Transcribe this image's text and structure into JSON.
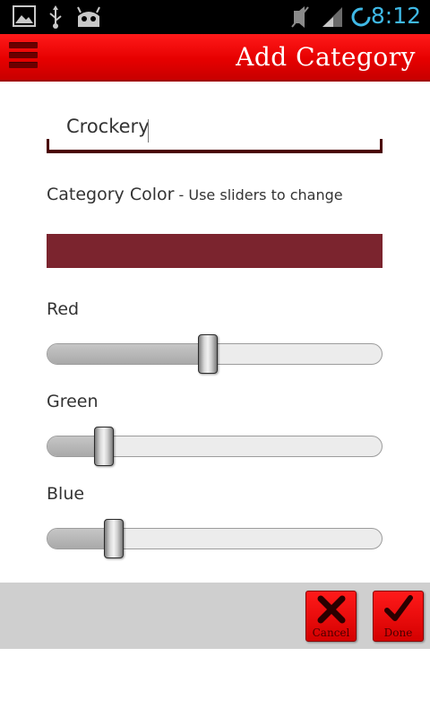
{
  "status_bar": {
    "time": "8:12",
    "icons": [
      "image-icon",
      "usb-icon",
      "android-robot-icon",
      "mute-icon",
      "signal-icon",
      "sync-icon"
    ]
  },
  "action_bar": {
    "title": "Add Category",
    "menu_icon": "menu-icon"
  },
  "form": {
    "name_value": "Crockery",
    "color_label": "Category Color",
    "color_hint": " - Use sliders to change",
    "swatch_color": "#7b242e"
  },
  "sliders": [
    {
      "label": "Red",
      "value": 0.48
    },
    {
      "label": "Green",
      "value": 0.17
    },
    {
      "label": "Blue",
      "value": 0.2
    }
  ],
  "buttons": {
    "cancel_label": "Cancel",
    "done_label": "Done"
  },
  "colors": {
    "accent": "#e60000",
    "dark_red": "#4a0000"
  }
}
